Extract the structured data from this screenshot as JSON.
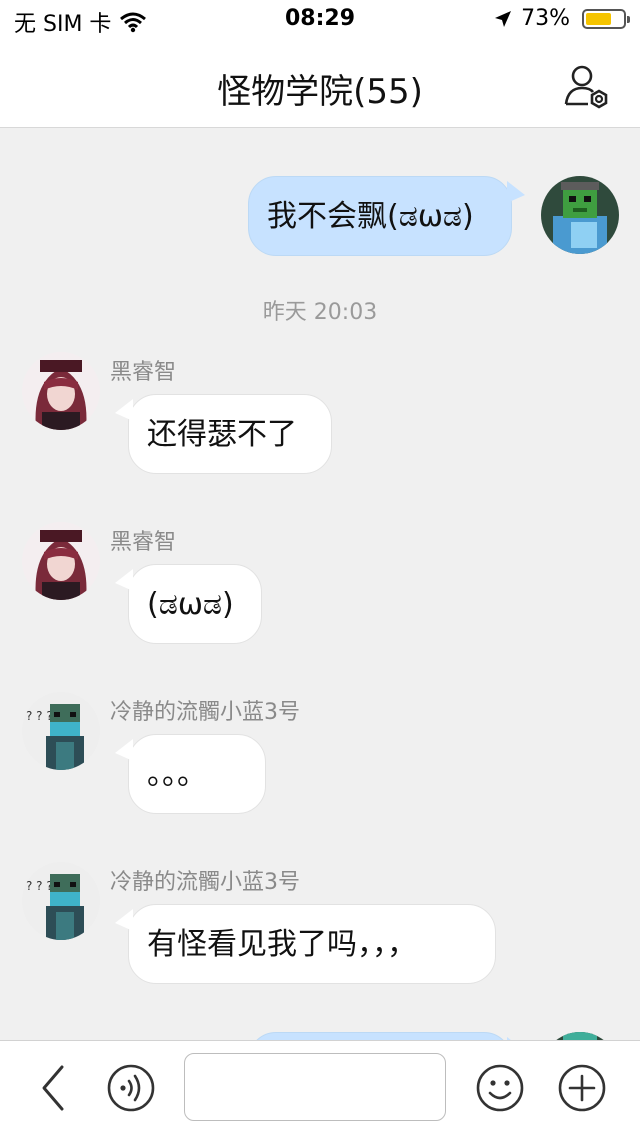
{
  "status_bar": {
    "carrier": "无 SIM 卡",
    "time": "08:29",
    "battery": "73%",
    "battery_level": 0.73
  },
  "nav": {
    "title": "怪物学院(55)",
    "settings_icon": "group-settings-icon"
  },
  "messages": [
    {
      "side": "right",
      "text": "我不会飘(ಡωಡ)",
      "avatar": "green-zombie-avatar"
    },
    {
      "timestamp": "昨天 20:03"
    },
    {
      "side": "left",
      "sender": "黑睿智",
      "text": "还得瑟不了",
      "avatar": "red-haired-girl-avatar"
    },
    {
      "side": "left",
      "sender": "黑睿智",
      "text": "(ಡωಡ)",
      "avatar": "red-haired-girl-avatar"
    },
    {
      "side": "left",
      "sender": "冷静的流髑小蓝3号",
      "text": "。。。",
      "avatar": "blue-masked-figure-avatar"
    },
    {
      "side": "left",
      "sender": "冷静的流髑小蓝3号",
      "text": "有怪看见我了吗，，，",
      "avatar": "blue-masked-figure-avatar"
    },
    {
      "side": "right",
      "text": "",
      "avatar": "green-zombie-avatar"
    }
  ],
  "toolbar": {
    "back_icon": "back-chevron-icon",
    "voice_icon": "voice-icon",
    "input_placeholder": "",
    "emoji_icon": "emoji-icon",
    "add_icon": "plus-icon"
  },
  "colors": {
    "outgoing_bubble": "#c7e2ff",
    "incoming_bubble": "#ffffff",
    "background": "#f0f0f0",
    "battery": "#f5c400"
  }
}
